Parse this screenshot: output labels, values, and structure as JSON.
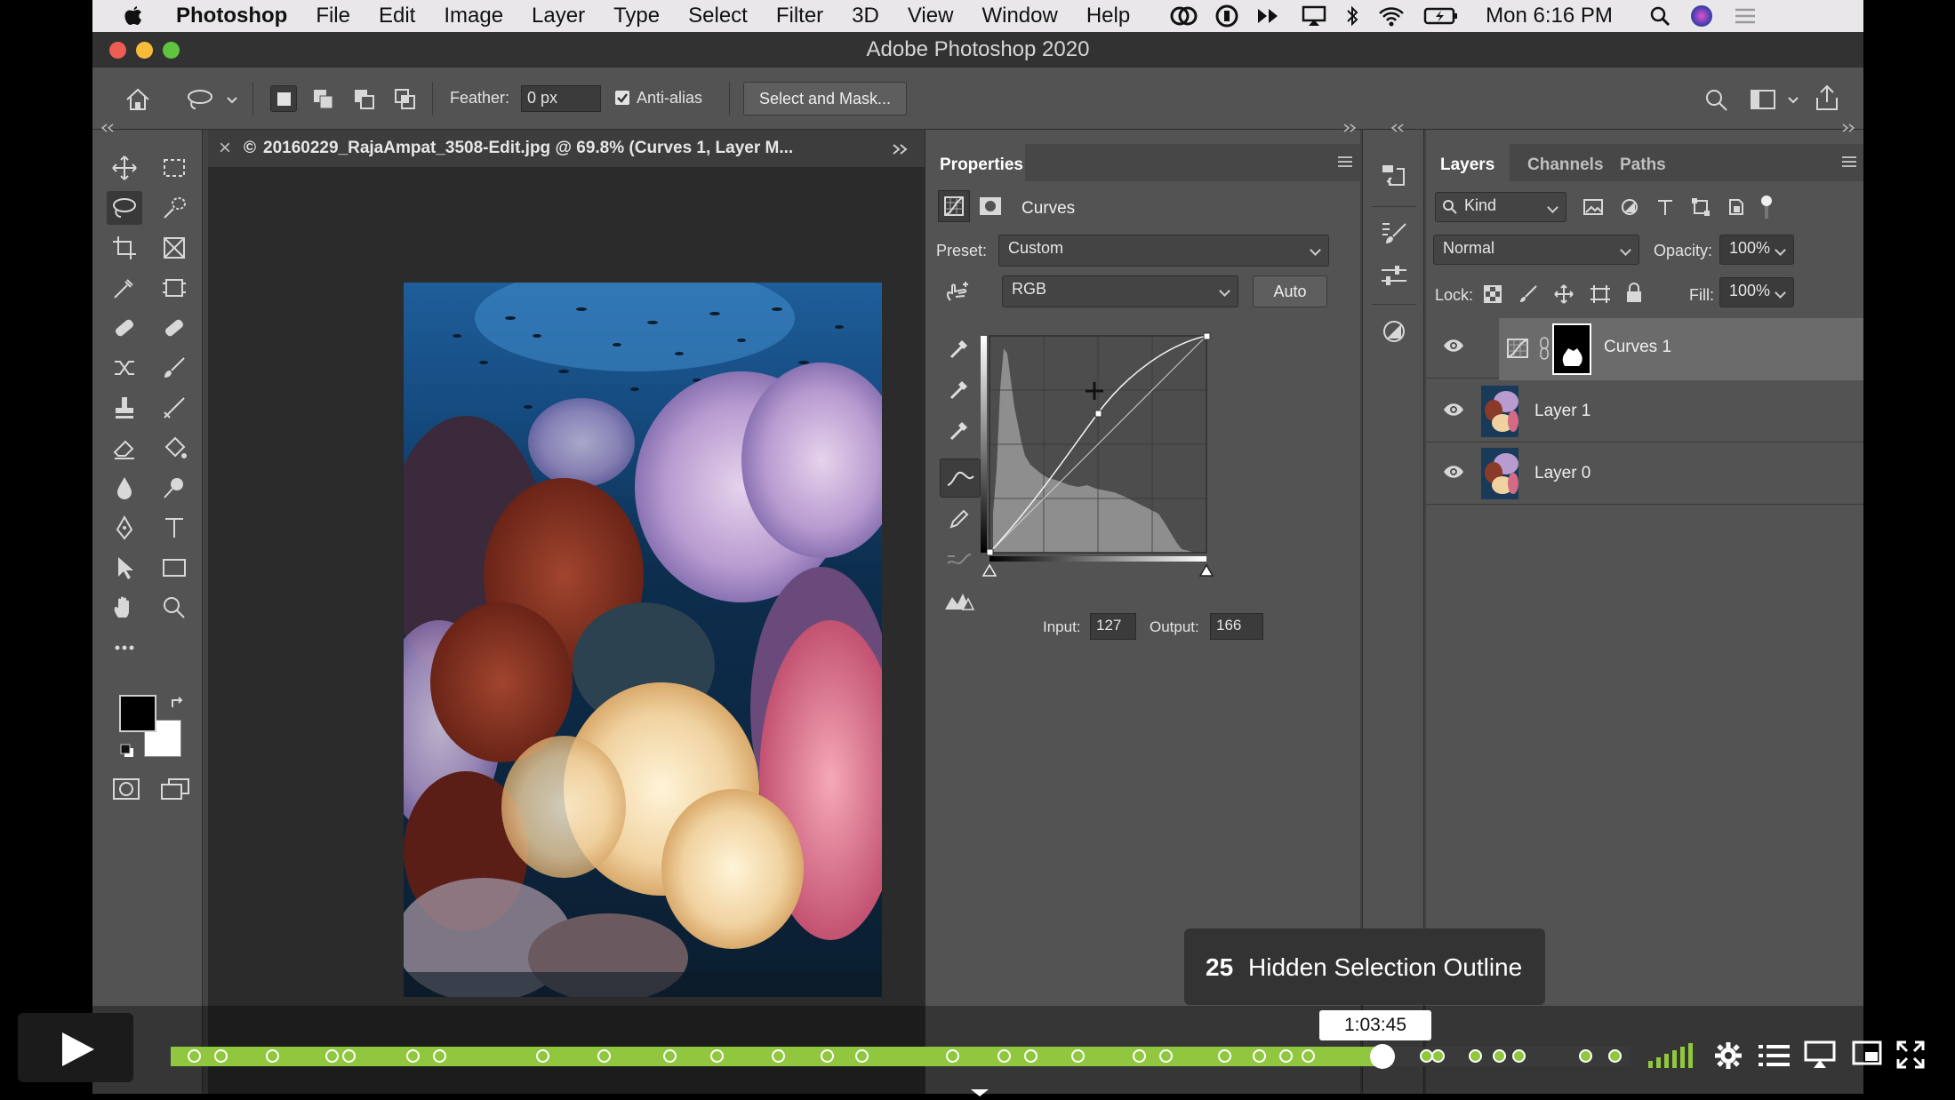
{
  "menubar": {
    "app_name": "Photoshop",
    "items": [
      "File",
      "Edit",
      "Image",
      "Layer",
      "Type",
      "Select",
      "Filter",
      "3D",
      "View",
      "Window",
      "Help"
    ],
    "clock": "Mon 6:16 PM"
  },
  "window": {
    "title": "Adobe Photoshop 2020"
  },
  "options_bar": {
    "feather_label": "Feather:",
    "feather_value": "0 px",
    "antialias_label": "Anti-alias",
    "select_mask_label": "Select and Mask..."
  },
  "document": {
    "tab_title": "20160229_RajaAmpat_3508-Edit.jpg @ 69.8% (Curves 1, Layer M...",
    "copyright_symbol": "©",
    "close_glyph": "×"
  },
  "properties": {
    "tab_label": "Properties",
    "adjustment_name": "Curves",
    "preset_label": "Preset:",
    "preset_value": "Custom",
    "channel_value": "RGB",
    "auto_label": "Auto",
    "input_label": "Input:",
    "input_value": "127",
    "output_label": "Output:",
    "output_value": "166"
  },
  "layers_panel": {
    "tabs": [
      "Layers",
      "Channels",
      "Paths"
    ],
    "filter_kind": "Kind",
    "blend_mode": "Normal",
    "opacity_label": "Opacity:",
    "opacity_value": "100%",
    "lock_label": "Lock:",
    "fill_label": "Fill:",
    "fill_value": "100%",
    "layers": [
      {
        "name": "Curves 1",
        "selected": true
      },
      {
        "name": "Layer 1",
        "selected": false
      },
      {
        "name": "Layer 0",
        "selected": false
      }
    ]
  },
  "video_player": {
    "chapter_number": "25",
    "chapter_title": "Hidden Selection Outline",
    "hover_time": "1:03:45",
    "hover_time_prefix": "1:",
    "progress_fraction": 0.83,
    "accent_color": "#90c73f"
  }
}
